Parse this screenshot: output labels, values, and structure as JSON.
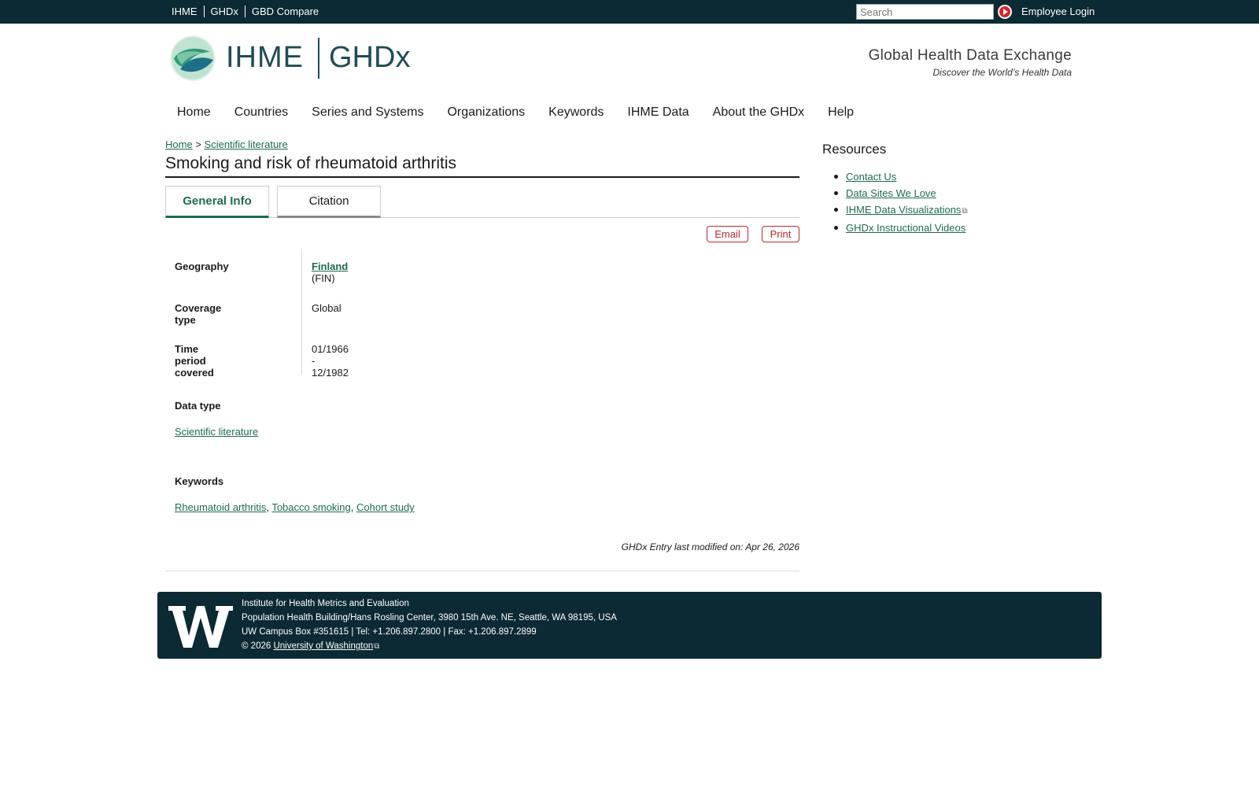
{
  "topbar": {
    "links": [
      "IHME",
      "GHDx",
      "GBD Compare"
    ],
    "search_placeholder": "Search",
    "employee_login": "Employee Login"
  },
  "header": {
    "logo_ihme": "IHME",
    "logo_ghdx": "GHDx",
    "tagline_title": "Global Health Data Exchange",
    "tagline_sub": "Discover the World’s Health Data"
  },
  "nav": {
    "items": [
      "Home",
      "Countries",
      "Series and Systems",
      "Organizations",
      "Keywords",
      "IHME Data",
      "About the GHDx",
      "Help"
    ]
  },
  "breadcrumb": {
    "home": "Home",
    "separator": ">",
    "current": "Scientific literature"
  },
  "page_title": "Smoking and risk of rheumatoid arthritis",
  "tabs": {
    "general": "General Info",
    "citation": "Citation"
  },
  "actions": {
    "email": "Email",
    "print": "Print"
  },
  "info": {
    "geography_label": "Geography",
    "geography_link": "Finland",
    "geography_code": "(FIN)",
    "coverage_label": "Coverage type",
    "coverage_value": "Global",
    "time_label": "Time period covered",
    "time_value": "01/1966 - 12/1982"
  },
  "data_type": {
    "label": "Data type",
    "value": "Scientific literature"
  },
  "keywords": {
    "label": "Keywords",
    "items": [
      "Rheumatoid arthritis",
      "Tobacco smoking",
      "Cohort study"
    ]
  },
  "modified": "GHDx Entry last modified on: Apr 26, 2026",
  "sidebar": {
    "title": "Resources",
    "items": [
      "Contact Us",
      "Data Sites We Love",
      "IHME Data Visualizations",
      "GHDx Instructional Videos"
    ]
  },
  "footer": {
    "line1": "Institute for Health Metrics and Evaluation",
    "line2": "Population Health Building/Hans Rosling Center, 3980 15th Ave. NE, Seattle, WA 98195, USA",
    "line3": "UW Campus Box #351615 | Tel: +1.206.897.2800 | Fax: +1.206.897.2899",
    "copyright": "© 2026",
    "uw_link": "University of Washington"
  },
  "colors": {
    "topbar_bg": "#0b2a33",
    "link_green": "#1e6b4e",
    "accent_red": "#c0272d"
  }
}
